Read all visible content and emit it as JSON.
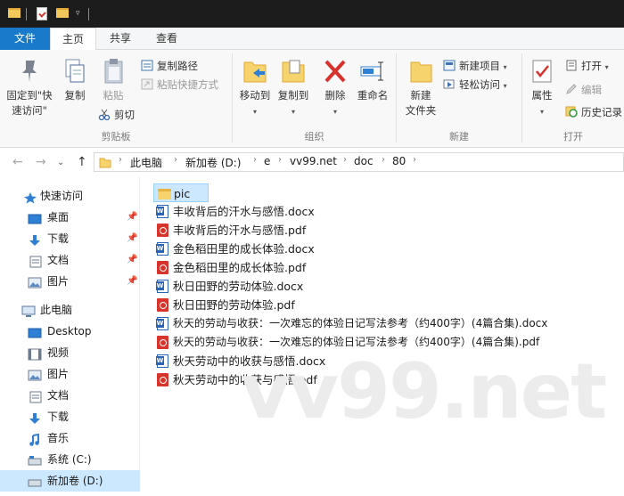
{
  "ribbon_tabs": {
    "file": "文件",
    "home": "主页",
    "share": "共享",
    "view": "查看"
  },
  "clipboard": {
    "pin_line1": "固定到\"快",
    "pin_line2": "速访问\"",
    "copy": "复制",
    "paste": "粘贴",
    "copy_path": "复制路径",
    "paste_shortcut": "粘贴快捷方式",
    "cut": "剪切",
    "label": "剪贴板"
  },
  "organize": {
    "move_to": "移动到",
    "copy_to": "复制到",
    "delete": "删除",
    "rename": "重命名",
    "label": "组织"
  },
  "new_group": {
    "new_folder_line1": "新建",
    "new_folder_line2": "文件夹",
    "new_item": "新建项目",
    "easy_access": "轻松访问",
    "label": "新建"
  },
  "open_group": {
    "properties": "属性",
    "open": "打开",
    "edit": "编辑",
    "history": "历史记录",
    "label": "打开"
  },
  "breadcrumbs": [
    "此电脑",
    "新加卷 (D:)",
    "e",
    "vv99.net",
    "doc",
    "80"
  ],
  "nav": {
    "quick_access": "快速访问",
    "desktop": "桌面",
    "downloads": "下载",
    "documents": "文档",
    "pictures": "图片",
    "this_pc": "此电脑",
    "desktop_en": "Desktop",
    "videos": "视频",
    "pictures2": "图片",
    "documents2": "文档",
    "downloads2": "下载",
    "music": "音乐",
    "system_c": "系统 (C:)",
    "new_volume_d": "新加卷 (D:)"
  },
  "files": [
    {
      "name": "pic",
      "type": "folder"
    },
    {
      "name": "丰收背后的汗水与感悟.docx",
      "type": "docx"
    },
    {
      "name": "丰收背后的汗水与感悟.pdf",
      "type": "pdf"
    },
    {
      "name": "金色稻田里的成长体验.docx",
      "type": "docx"
    },
    {
      "name": "金色稻田里的成长体验.pdf",
      "type": "pdf"
    },
    {
      "name": "秋日田野的劳动体验.docx",
      "type": "docx"
    },
    {
      "name": "秋日田野的劳动体验.pdf",
      "type": "pdf"
    },
    {
      "name": "秋天的劳动与收获：一次难忘的体验日记写法参考（约400字）(4篇合集).docx",
      "type": "docx"
    },
    {
      "name": "秋天的劳动与收获：一次难忘的体验日记写法参考（约400字）(4篇合集).pdf",
      "type": "pdf"
    },
    {
      "name": "秋天劳动中的收获与感悟.docx",
      "type": "docx"
    },
    {
      "name": "秋天劳动中的收获与感悟.pdf",
      "type": "pdf"
    }
  ],
  "watermark": "vv99.net"
}
